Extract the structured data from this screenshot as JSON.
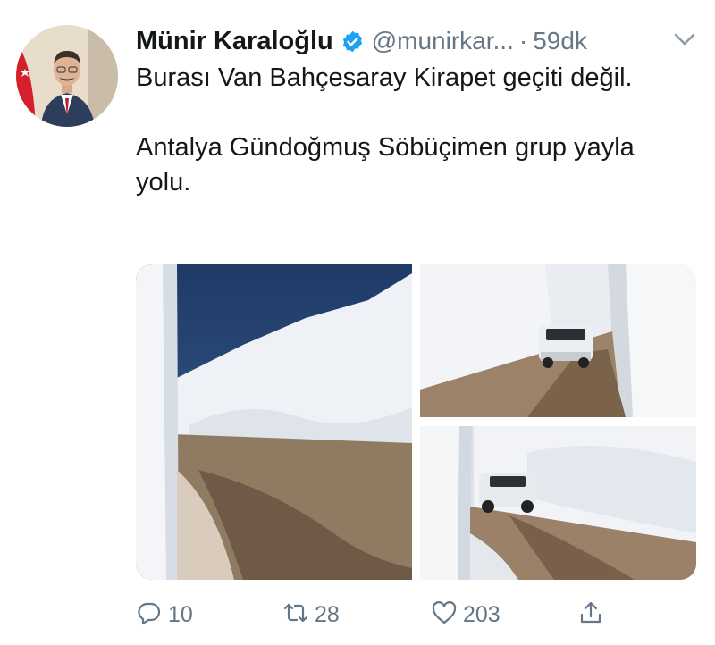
{
  "author": {
    "name": "Münir Karaloğlu",
    "handle": "@munirkar...",
    "separator": "·",
    "time": "59dk"
  },
  "tweet": {
    "paragraphs": [
      "Burası Van Bahçesaray Kirapet geçiti değil.",
      "Antalya Gündoğmuş Söbüçimen grup yayla yolu."
    ]
  },
  "actions": {
    "replies": "10",
    "retweets": "28",
    "likes": "203"
  },
  "colors": {
    "text": "#14171a",
    "muted": "#657786",
    "verified": "#1da1f2"
  },
  "icons": [
    "verified-badge-icon",
    "chevron-down-icon",
    "reply-icon",
    "retweet-icon",
    "like-icon",
    "share-icon"
  ]
}
